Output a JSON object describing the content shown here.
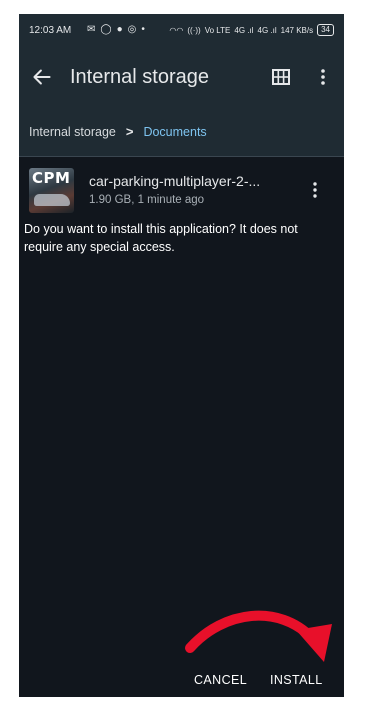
{
  "status_bar": {
    "time": "12:03 AM",
    "left_icons": [
      "✉",
      "◯",
      "●",
      "◎",
      "•"
    ],
    "right_icons": [
      "◠◠",
      "((·))",
      "Vo LTE",
      "4G .ıl",
      "4G .ıl",
      "147 KB/s"
    ],
    "battery": "34"
  },
  "app_bar": {
    "title": "Internal storage"
  },
  "breadcrumb": {
    "root": "Internal storage",
    "separator": ">",
    "current": "Documents"
  },
  "file": {
    "name": "car-parking-multiplayer-2-...",
    "meta": "1.90 GB, 1 minute ago",
    "thumb_text": "CPM"
  },
  "prompt": {
    "text": "Do you want to install this application? It does not require any special access."
  },
  "actions": {
    "cancel": "CANCEL",
    "install": "INSTALL"
  },
  "colors": {
    "accent": "#7ec4f0",
    "annotation_arrow": "#e8102a"
  }
}
